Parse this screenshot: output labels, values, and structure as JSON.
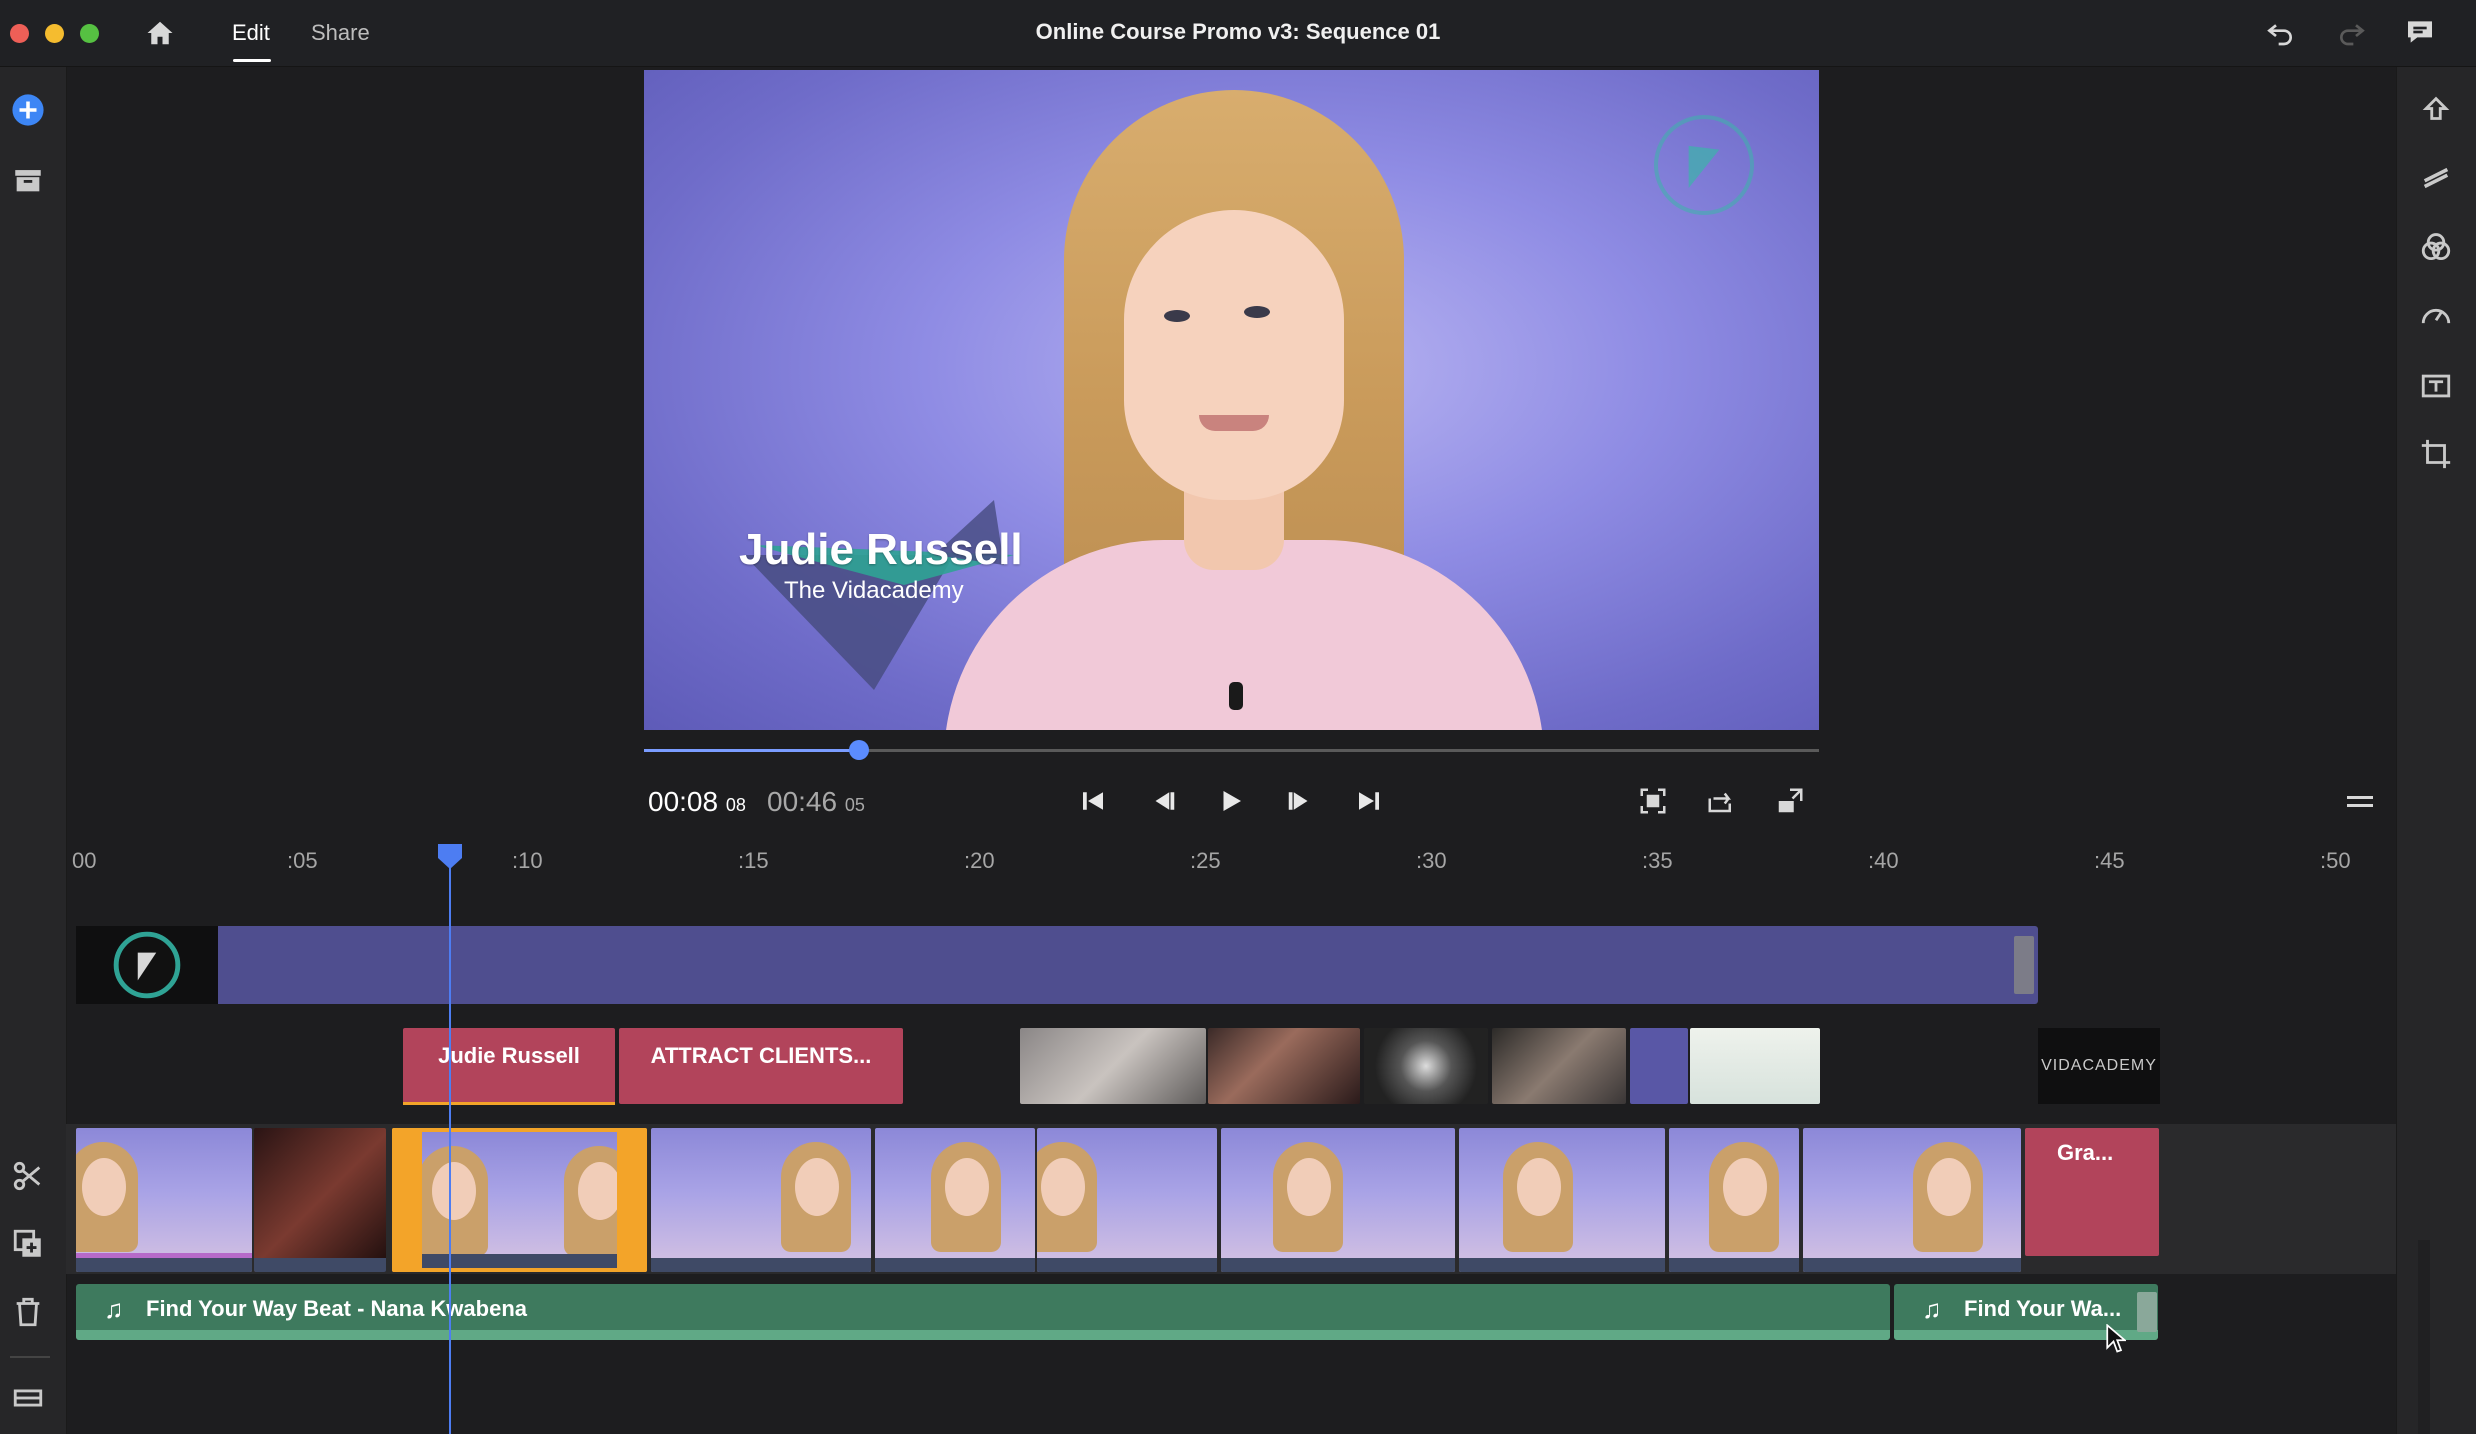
{
  "app": {
    "window_title": "Online Course Promo v3: Sequence 01",
    "tabs": [
      {
        "label": "Edit",
        "active": true
      },
      {
        "label": "Share",
        "active": false
      }
    ]
  },
  "preview": {
    "lower_third_name": "Judie Russell",
    "lower_third_subtitle": "The Vidacademy"
  },
  "playback": {
    "current_time": "00:08",
    "current_frames": "08",
    "total_time": "00:46",
    "total_frames": "05",
    "scrub_position_fraction": 0.183
  },
  "ruler": {
    "labels": [
      "00",
      ":05",
      ":10",
      ":15",
      ":20",
      ":25",
      ":30",
      ":35",
      ":40",
      ":45",
      ":50"
    ]
  },
  "timeline": {
    "title_clips": [
      "Judie Russell",
      "ATTRACT CLIENTS..."
    ],
    "end_graphic_label": "VIDACADEMY",
    "graphic_clip_label": "Gra...",
    "audio_clips": [
      "Find Your Way Beat - Nana Kwabena",
      "Find Your Wa..."
    ]
  },
  "colors": {
    "accent": "#4d7df2",
    "selection": "#f3a429",
    "title_clip": "#b2445b",
    "audio_clip": "#3e7a5e",
    "graphics_track": "#4f4e8f"
  },
  "icons": {
    "left_rail": [
      "add-media-icon",
      "library-icon",
      "scissors-icon",
      "duplicate-icon",
      "trash-icon",
      "track-height-icon"
    ],
    "right_rail": [
      "upload-icon",
      "transitions-icon",
      "color-icon",
      "speed-icon",
      "titles-icon",
      "crop-icon"
    ],
    "top_bar": [
      "home-icon",
      "undo-icon",
      "redo-icon",
      "comment-icon"
    ]
  }
}
